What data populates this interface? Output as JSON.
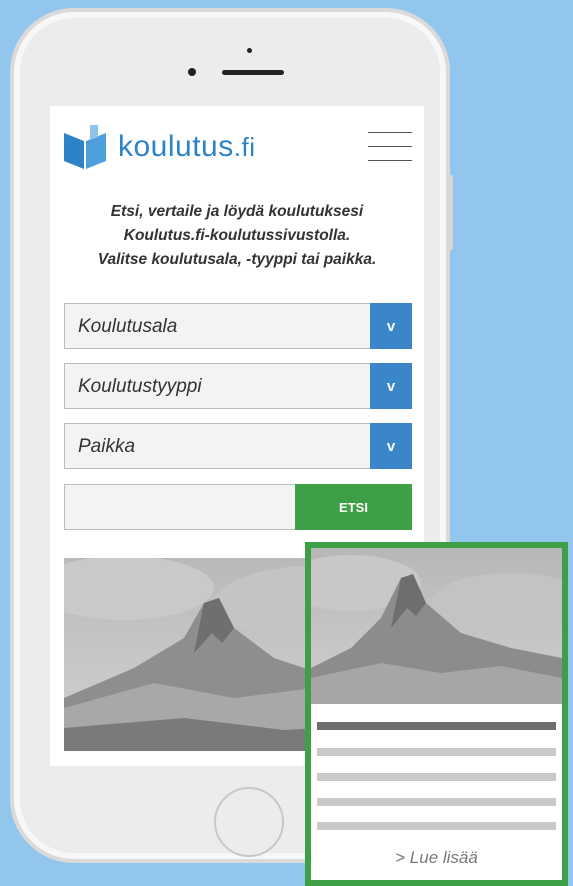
{
  "brand": {
    "name_main": "koulutus",
    "name_suffix": ".fi",
    "color": "#2e83c8"
  },
  "header": {
    "menu_icon": "hamburger-menu-icon"
  },
  "intro": {
    "line1": "Etsi, vertaile ja löydä koulutuksesi",
    "line2": "Koulutus.fi-koulutussivustolla.",
    "line3": "Valitse koulutusala, -tyyppi tai paikka."
  },
  "filters": {
    "field": {
      "label": "Koulutusala",
      "arrow": "v"
    },
    "type": {
      "label": "Koulutustyyppi",
      "arrow": "v"
    },
    "place": {
      "label": "Paikka",
      "arrow": "v"
    }
  },
  "search": {
    "value": "",
    "button_label": "ETSI"
  },
  "card": {
    "read_more": "> Lue lisää"
  },
  "colors": {
    "background": "#93c6ec",
    "accent_blue": "#3a86c9",
    "accent_green": "#3ea046"
  }
}
